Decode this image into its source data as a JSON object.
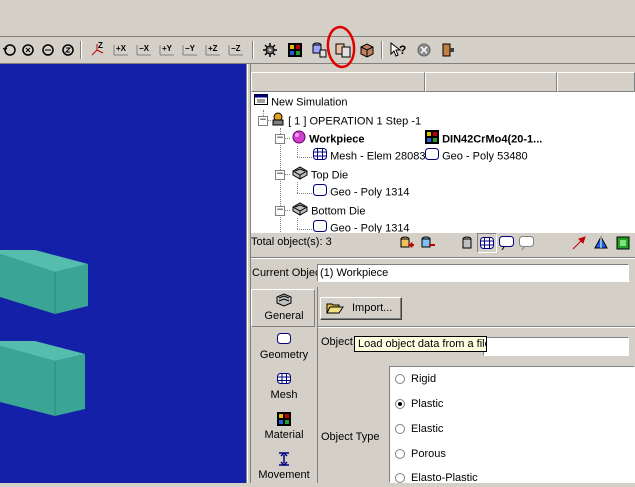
{
  "toolbar": {
    "axis_buttons": [
      "Z",
      "+X",
      "−X",
      "+Y",
      "−Y",
      "+Z",
      "−Z"
    ],
    "highlight_color": "#e00000"
  },
  "tree": {
    "root": "New Simulation",
    "operation": "[ 1 ]  OPERATION 1  Step -1",
    "workpiece": "Workpiece",
    "workpiece_material": "DIN42CrMo4(20-1...",
    "workpiece_mesh": "Mesh - Elem 28083",
    "workpiece_geo": "Geo - Poly 53480",
    "top_die": "Top Die",
    "top_die_geo": "Geo - Poly 1314",
    "bottom_die": "Bottom Die",
    "bottom_die_geo": "Geo - Poly 1314"
  },
  "status": {
    "total_objects": "Total object(s): 3"
  },
  "current_object": {
    "label": "Current Objec",
    "value": "(1) Workpiece"
  },
  "tabs": [
    "General",
    "Geometry",
    "Mesh",
    "Material",
    "Movement"
  ],
  "general": {
    "import_label": "Import...",
    "tooltip": "Load object data from a file",
    "object_name_label": "Object",
    "object_type_label": "Object Type",
    "object_types": [
      "Rigid",
      "Plastic",
      "Elastic",
      "Porous",
      "Elasto-Plastic"
    ],
    "selected_type": "Plastic"
  },
  "colors": {
    "viewport_bg": "#1420a8",
    "object_color": "#3aa595",
    "tooltip_bg": "#ffffe1"
  }
}
